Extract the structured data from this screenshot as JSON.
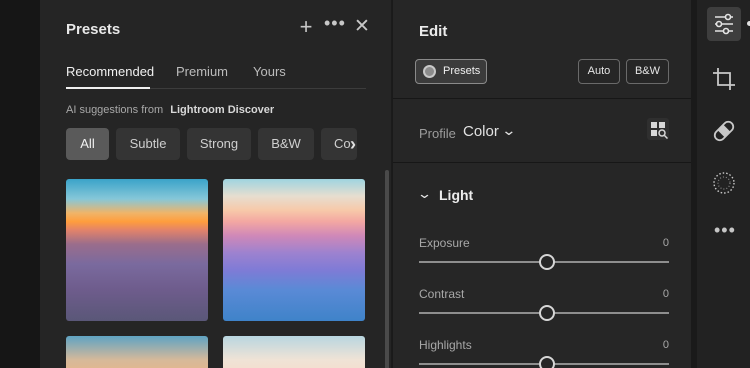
{
  "presets_panel": {
    "title": "Presets",
    "tabs": [
      {
        "label": "Recommended",
        "active": true
      },
      {
        "label": "Premium",
        "active": false
      },
      {
        "label": "Yours",
        "active": false
      }
    ],
    "ai_prefix": "AI suggestions from",
    "ai_source": "Lightroom Discover",
    "chips": [
      {
        "label": "All",
        "active": true
      },
      {
        "label": "Subtle",
        "active": false
      },
      {
        "label": "Strong",
        "active": false
      },
      {
        "label": "B&W",
        "active": false
      },
      {
        "label": "Co",
        "active": false
      }
    ],
    "icons": {
      "add": "plus-icon",
      "more": "ellipsis-icon",
      "close": "close-icon",
      "next": "chevron-right-icon"
    }
  },
  "edit_panel": {
    "title": "Edit",
    "presets_button": "Presets",
    "auto_button": "Auto",
    "bw_button": "B&W",
    "profile_label": "Profile",
    "profile_value": "Color",
    "section_title": "Light",
    "sliders": [
      {
        "label": "Exposure",
        "value": "0"
      },
      {
        "label": "Contrast",
        "value": "0"
      },
      {
        "label": "Highlights",
        "value": "0"
      }
    ]
  },
  "toolbar": {
    "tools": [
      "edit-sliders-icon",
      "crop-icon",
      "healing-bandage-icon",
      "masking-icon",
      "more-tools-icon"
    ]
  }
}
